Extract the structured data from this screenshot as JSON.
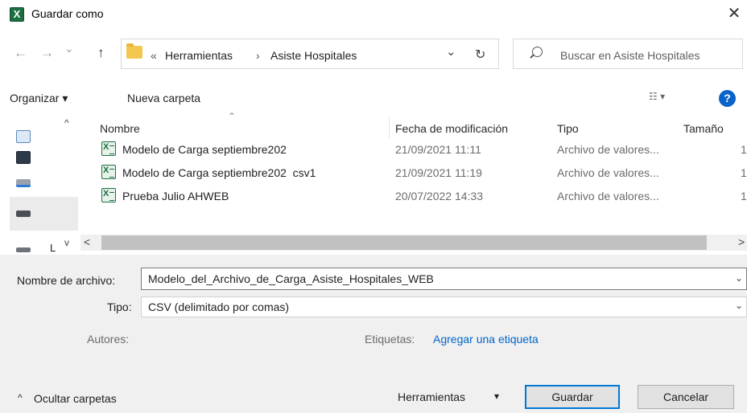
{
  "window": {
    "title": "Guardar como",
    "close_glyph": "✕",
    "app_icon_letter": "X"
  },
  "nav": {
    "back_glyph": "←",
    "forward_glyph": "→",
    "recent_glyph": "⌄",
    "up_glyph": "↑",
    "overflow_glyph": "«",
    "crumb_1": "Herramientas",
    "crumb_sep": "›",
    "crumb_2": "Asiste Hospitales",
    "dropdown_glyph": "⌄",
    "refresh_glyph": "↻",
    "search_placeholder": "Buscar en Asiste Hospitales"
  },
  "toolbar": {
    "organize_label": "Organizar ▾",
    "new_folder_label": "Nueva carpeta",
    "view_glyph": "☷ ▾",
    "help_glyph": "?"
  },
  "sidebar": {
    "partial_label": "L",
    "scroll_up": "^",
    "scroll_down": "v"
  },
  "file_list": {
    "columns": {
      "name": "Nombre",
      "modified": "Fecha de modificación",
      "type": "Tipo",
      "size": "Tamaño"
    },
    "rows": [
      {
        "name": "Modelo de Carga septiembre202",
        "modified": "21/09/2021 11:11",
        "type": "Archivo de valores...",
        "size": "1"
      },
      {
        "name": "Modelo de Carga septiembre202  csv1",
        "modified": "21/09/2021 11:19",
        "type": "Archivo de valores...",
        "size": "1"
      },
      {
        "name": "Prueba Julio AHWEB",
        "modified": "20/07/2022 14:33",
        "type": "Archivo de valores...",
        "size": "1"
      }
    ],
    "scroll_left": "<",
    "scroll_right": ">"
  },
  "form": {
    "filename_label": "Nombre de archivo:",
    "filename_value": "Modelo_del_Archivo_de_Carga_Asiste_Hospitales_WEB",
    "type_label": "Tipo:",
    "type_value": "CSV (delimitado por comas)",
    "authors_label": "Autores:",
    "tags_label": "Etiquetas:",
    "tags_link": "Agregar una etiqueta",
    "chevron": "⌄"
  },
  "footer": {
    "hide_folders": "Ocultar carpetas",
    "hide_glyph": "^",
    "tools_label": "Herramientas",
    "tools_glyph": "▾",
    "save_label": "Guardar",
    "cancel_label": "Cancelar"
  }
}
